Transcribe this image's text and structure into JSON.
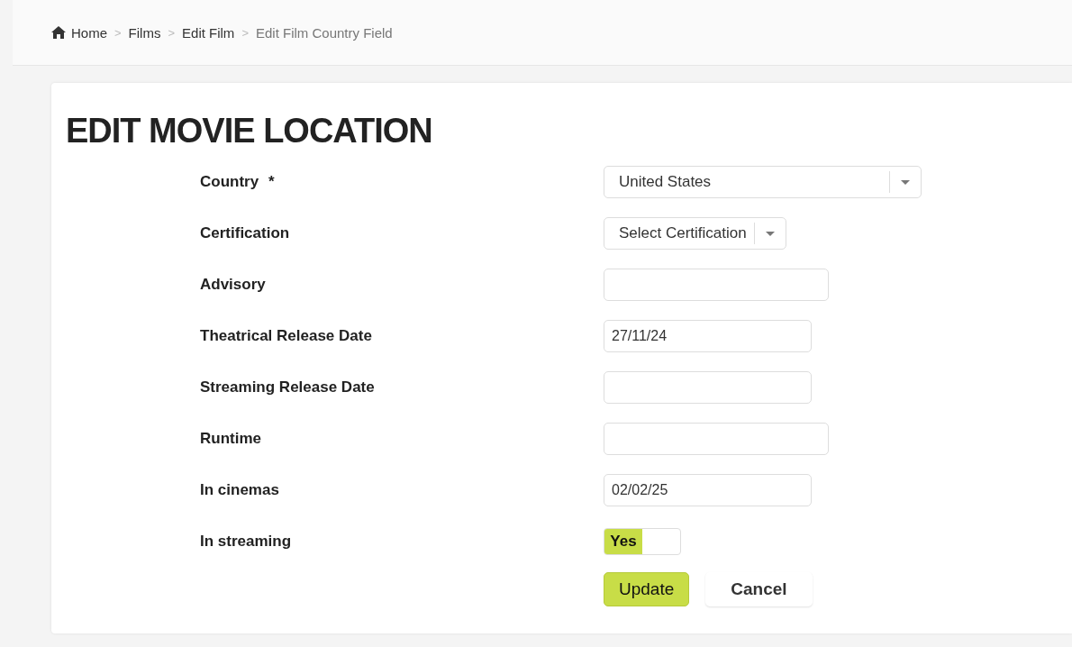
{
  "breadcrumb": [
    {
      "label": "Home",
      "current": false
    },
    {
      "label": "Films",
      "current": false
    },
    {
      "label": "Edit Film",
      "current": false
    },
    {
      "label": "Edit Film Country Field",
      "current": true
    }
  ],
  "separator": ">",
  "title": "EDIT MOVIE LOCATION",
  "fields": [
    {
      "label": "Country",
      "required": true,
      "kind": "select",
      "value": "United States"
    },
    {
      "label": "Certification",
      "required": false,
      "kind": "select",
      "placeholder": "Select Certification"
    },
    {
      "label": "Advisory",
      "required": false,
      "kind": "text"
    },
    {
      "label": "Theatrical Release Date",
      "required": false,
      "kind": "date",
      "value": "27/11/24"
    },
    {
      "label": "Streaming Release Date",
      "required": false,
      "kind": "date"
    },
    {
      "label": "Runtime",
      "required": false,
      "kind": "text"
    },
    {
      "label": "In cinemas",
      "required": false,
      "kind": "date",
      "value": "02/02/25"
    },
    {
      "label": "In streaming",
      "required": false,
      "kind": "toggle",
      "on": true,
      "on_label": "Yes"
    }
  ],
  "required_mark": "*",
  "buttons": [
    {
      "label": "Update",
      "kind": "primary"
    },
    {
      "label": "Cancel",
      "kind": "plain"
    }
  ]
}
